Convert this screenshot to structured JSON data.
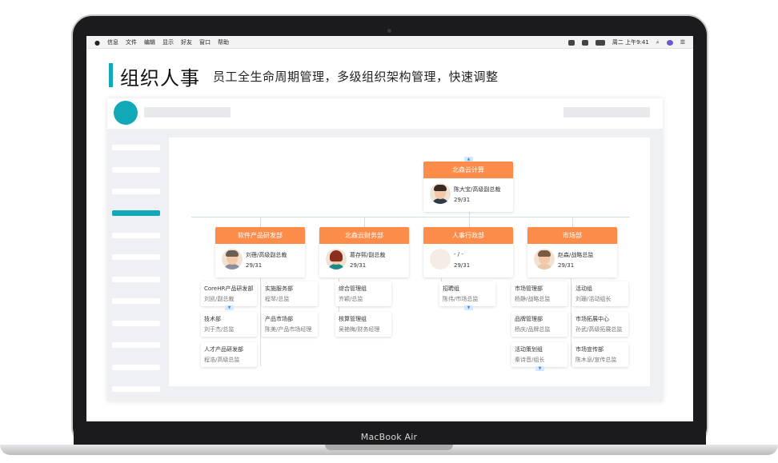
{
  "device_label": "MacBook Air",
  "menubar": {
    "items": [
      "信息",
      "文件",
      "编辑",
      "显示",
      "好友",
      "窗口",
      "帮助"
    ],
    "clock": "周二 上午9:41"
  },
  "header": {
    "title": "组织人事",
    "subtitle": "员工全生命周期管理，多级组织架构管理，快速调整"
  },
  "org": {
    "root": {
      "dept": "北森云计算",
      "person": "陈大宝/高级副总裁",
      "count": "29/31"
    },
    "departments": [
      {
        "dept": "软件产品研发部",
        "person": "刘蓓/高级副总裁",
        "count": "29/31"
      },
      {
        "dept": "北森云财务部",
        "person": "葛存熙/副总裁",
        "count": "29/31"
      },
      {
        "dept": "人事行政部",
        "person": "- / -",
        "count": "29/31"
      },
      {
        "dept": "市场部",
        "person": "赵森/战略总监",
        "count": "29/31"
      }
    ],
    "groups": {
      "software_col1": [
        {
          "name": "CoreHR产品研发部",
          "lead": "刘凯/副总裁"
        },
        {
          "name": "技术部",
          "lead": "刘于杰/总监"
        },
        {
          "name": "人才产品研发部",
          "lead": "程浩/高级总监"
        }
      ],
      "software_col2": [
        {
          "name": "实施服务部",
          "lead": "程琴/总监"
        },
        {
          "name": "产品市场部",
          "lead": "陈美/产品市场经理"
        }
      ],
      "finance": [
        {
          "name": "综合管理组",
          "lead": "齐颖/总监"
        },
        {
          "name": "核算管理组",
          "lead": "吴艳梅/财务经理"
        }
      ],
      "hr": [
        {
          "name": "招聘组",
          "lead": "陈伟/市场总监"
        }
      ],
      "market_col1": [
        {
          "name": "市场管理部",
          "lead": "杨静/战略总监"
        },
        {
          "name": "品牌管理部",
          "lead": "杨庆/品牌总监"
        },
        {
          "name": "活动策划组",
          "lead": "秦诗音/组长"
        }
      ],
      "market_col2": [
        {
          "name": "活动组",
          "lead": "刘珊/活动组长"
        },
        {
          "name": "市场拓展中心",
          "lead": "孙武/高级拓展总监"
        },
        {
          "name": "市场宣传部",
          "lead": "陈木息/宣传总监"
        }
      ]
    }
  },
  "colors": {
    "accent": "#12a8b7",
    "orange": "#fb8c49"
  }
}
